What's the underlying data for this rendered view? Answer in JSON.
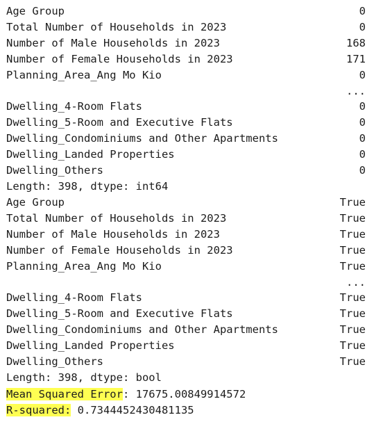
{
  "series_int": {
    "rows": [
      {
        "label": "Age Group",
        "value": "0"
      },
      {
        "label": "Total Number of Households in 2023",
        "value": "0"
      },
      {
        "label": "Number of Male Households in 2023",
        "value": "168"
      },
      {
        "label": "Number of Female Households in 2023",
        "value": "171"
      },
      {
        "label": "Planning_Area_Ang Mo Kio",
        "value": "0"
      },
      {
        "label": "",
        "value": "..."
      },
      {
        "label": "Dwelling_4-Room Flats",
        "value": "0"
      },
      {
        "label": "Dwelling_5-Room and Executive Flats",
        "value": "0"
      },
      {
        "label": "Dwelling_Condominiums and Other Apartments",
        "value": "0"
      },
      {
        "label": "Dwelling_Landed Properties",
        "value": "0"
      },
      {
        "label": "Dwelling_Others",
        "value": "0"
      }
    ],
    "footer": "Length: 398, dtype: int64"
  },
  "series_bool": {
    "rows": [
      {
        "label": "Age Group",
        "value": "True"
      },
      {
        "label": "Total Number of Households in 2023",
        "value": "True"
      },
      {
        "label": "Number of Male Households in 2023",
        "value": "True"
      },
      {
        "label": "Number of Female Households in 2023",
        "value": "True"
      },
      {
        "label": "Planning_Area_Ang Mo Kio",
        "value": "True"
      },
      {
        "label": "",
        "value": "..."
      },
      {
        "label": "Dwelling_4-Room Flats",
        "value": "True"
      },
      {
        "label": "Dwelling_5-Room and Executive Flats",
        "value": "True"
      },
      {
        "label": "Dwelling_Condominiums and Other Apartments",
        "value": "True"
      },
      {
        "label": "Dwelling_Landed Properties",
        "value": "True"
      },
      {
        "label": "Dwelling_Others",
        "value": "True"
      }
    ],
    "footer": "Length: 398, dtype: bool"
  },
  "metrics": {
    "mse_label": "Mean Squared Error",
    "mse_value": ": 17675.00849914572",
    "r2_label": "R-squared:",
    "r2_value": " 0.7344452430481135"
  },
  "colors": {
    "highlight": "#ffff52",
    "text": "#1c1c1c",
    "background": "#ffffff"
  }
}
